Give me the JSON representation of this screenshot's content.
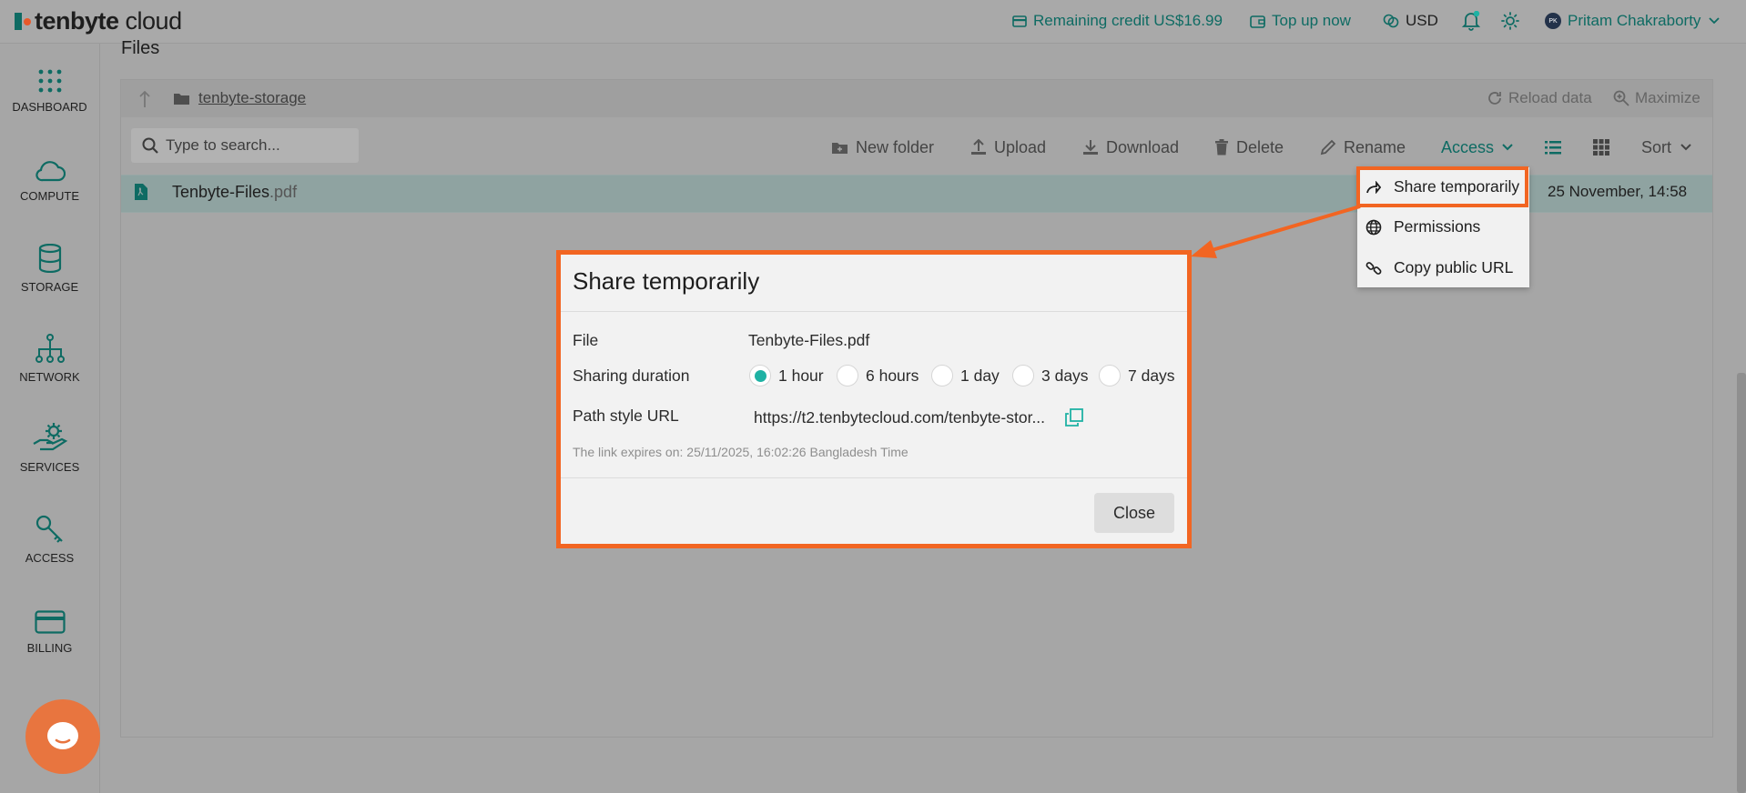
{
  "header": {
    "logo": {
      "brand": "tenbyte",
      "suffix": "cloud"
    },
    "credit": "Remaining credit US$16.99",
    "topup": "Top up now",
    "currency": "USD",
    "user_initials": "PK",
    "user_name": "Pritam Chakraborty"
  },
  "sidebar": {
    "items": [
      {
        "label": "DASHBOARD",
        "icon": "dashboard-grid-icon"
      },
      {
        "label": "COMPUTE",
        "icon": "cloud-icon"
      },
      {
        "label": "STORAGE",
        "icon": "database-icon"
      },
      {
        "label": "NETWORK",
        "icon": "network-icon"
      },
      {
        "label": "SERVICES",
        "icon": "services-gear-hand-icon"
      },
      {
        "label": "ACCESS",
        "icon": "key-icon"
      },
      {
        "label": "BILLING",
        "icon": "credit-card-icon"
      }
    ]
  },
  "page": {
    "title": "Files"
  },
  "breadcrumb": {
    "bucket": "tenbyte-storage"
  },
  "path_actions": {
    "reload": "Reload data",
    "maximize": "Maximize"
  },
  "search": {
    "placeholder": "Type to search..."
  },
  "toolbar": {
    "new_folder": "New folder",
    "upload": "Upload",
    "download": "Download",
    "delete": "Delete",
    "rename": "Rename",
    "access": "Access",
    "sort": "Sort"
  },
  "file": {
    "name": "Tenbyte-Files",
    "ext": ".pdf",
    "date": "25 November, 14:58"
  },
  "access_menu": {
    "items": [
      {
        "label": "Share temporarily",
        "icon": "share-arrow-icon"
      },
      {
        "label": "Permissions",
        "icon": "globe-icon"
      },
      {
        "label": "Copy public URL",
        "icon": "link-icon"
      }
    ]
  },
  "dialog": {
    "title": "Share temporarily",
    "file_label": "File",
    "file_value": "Tenbyte-Files.pdf",
    "duration_label": "Sharing duration",
    "durations": [
      "1 hour",
      "6 hours",
      "1 day",
      "3 days",
      "7 days"
    ],
    "selected_duration": "1 hour",
    "url_label": "Path style URL",
    "url_value": "https://t2.tenbytecloud.com/tenbyte-stor...",
    "expires": "The link expires on: 25/11/2025, 16:02:26 Bangladesh Time",
    "close": "Close"
  },
  "colors": {
    "accent": "#1fb2a4",
    "highlight": "#f26522",
    "brand_teal": "#0e6b63"
  }
}
